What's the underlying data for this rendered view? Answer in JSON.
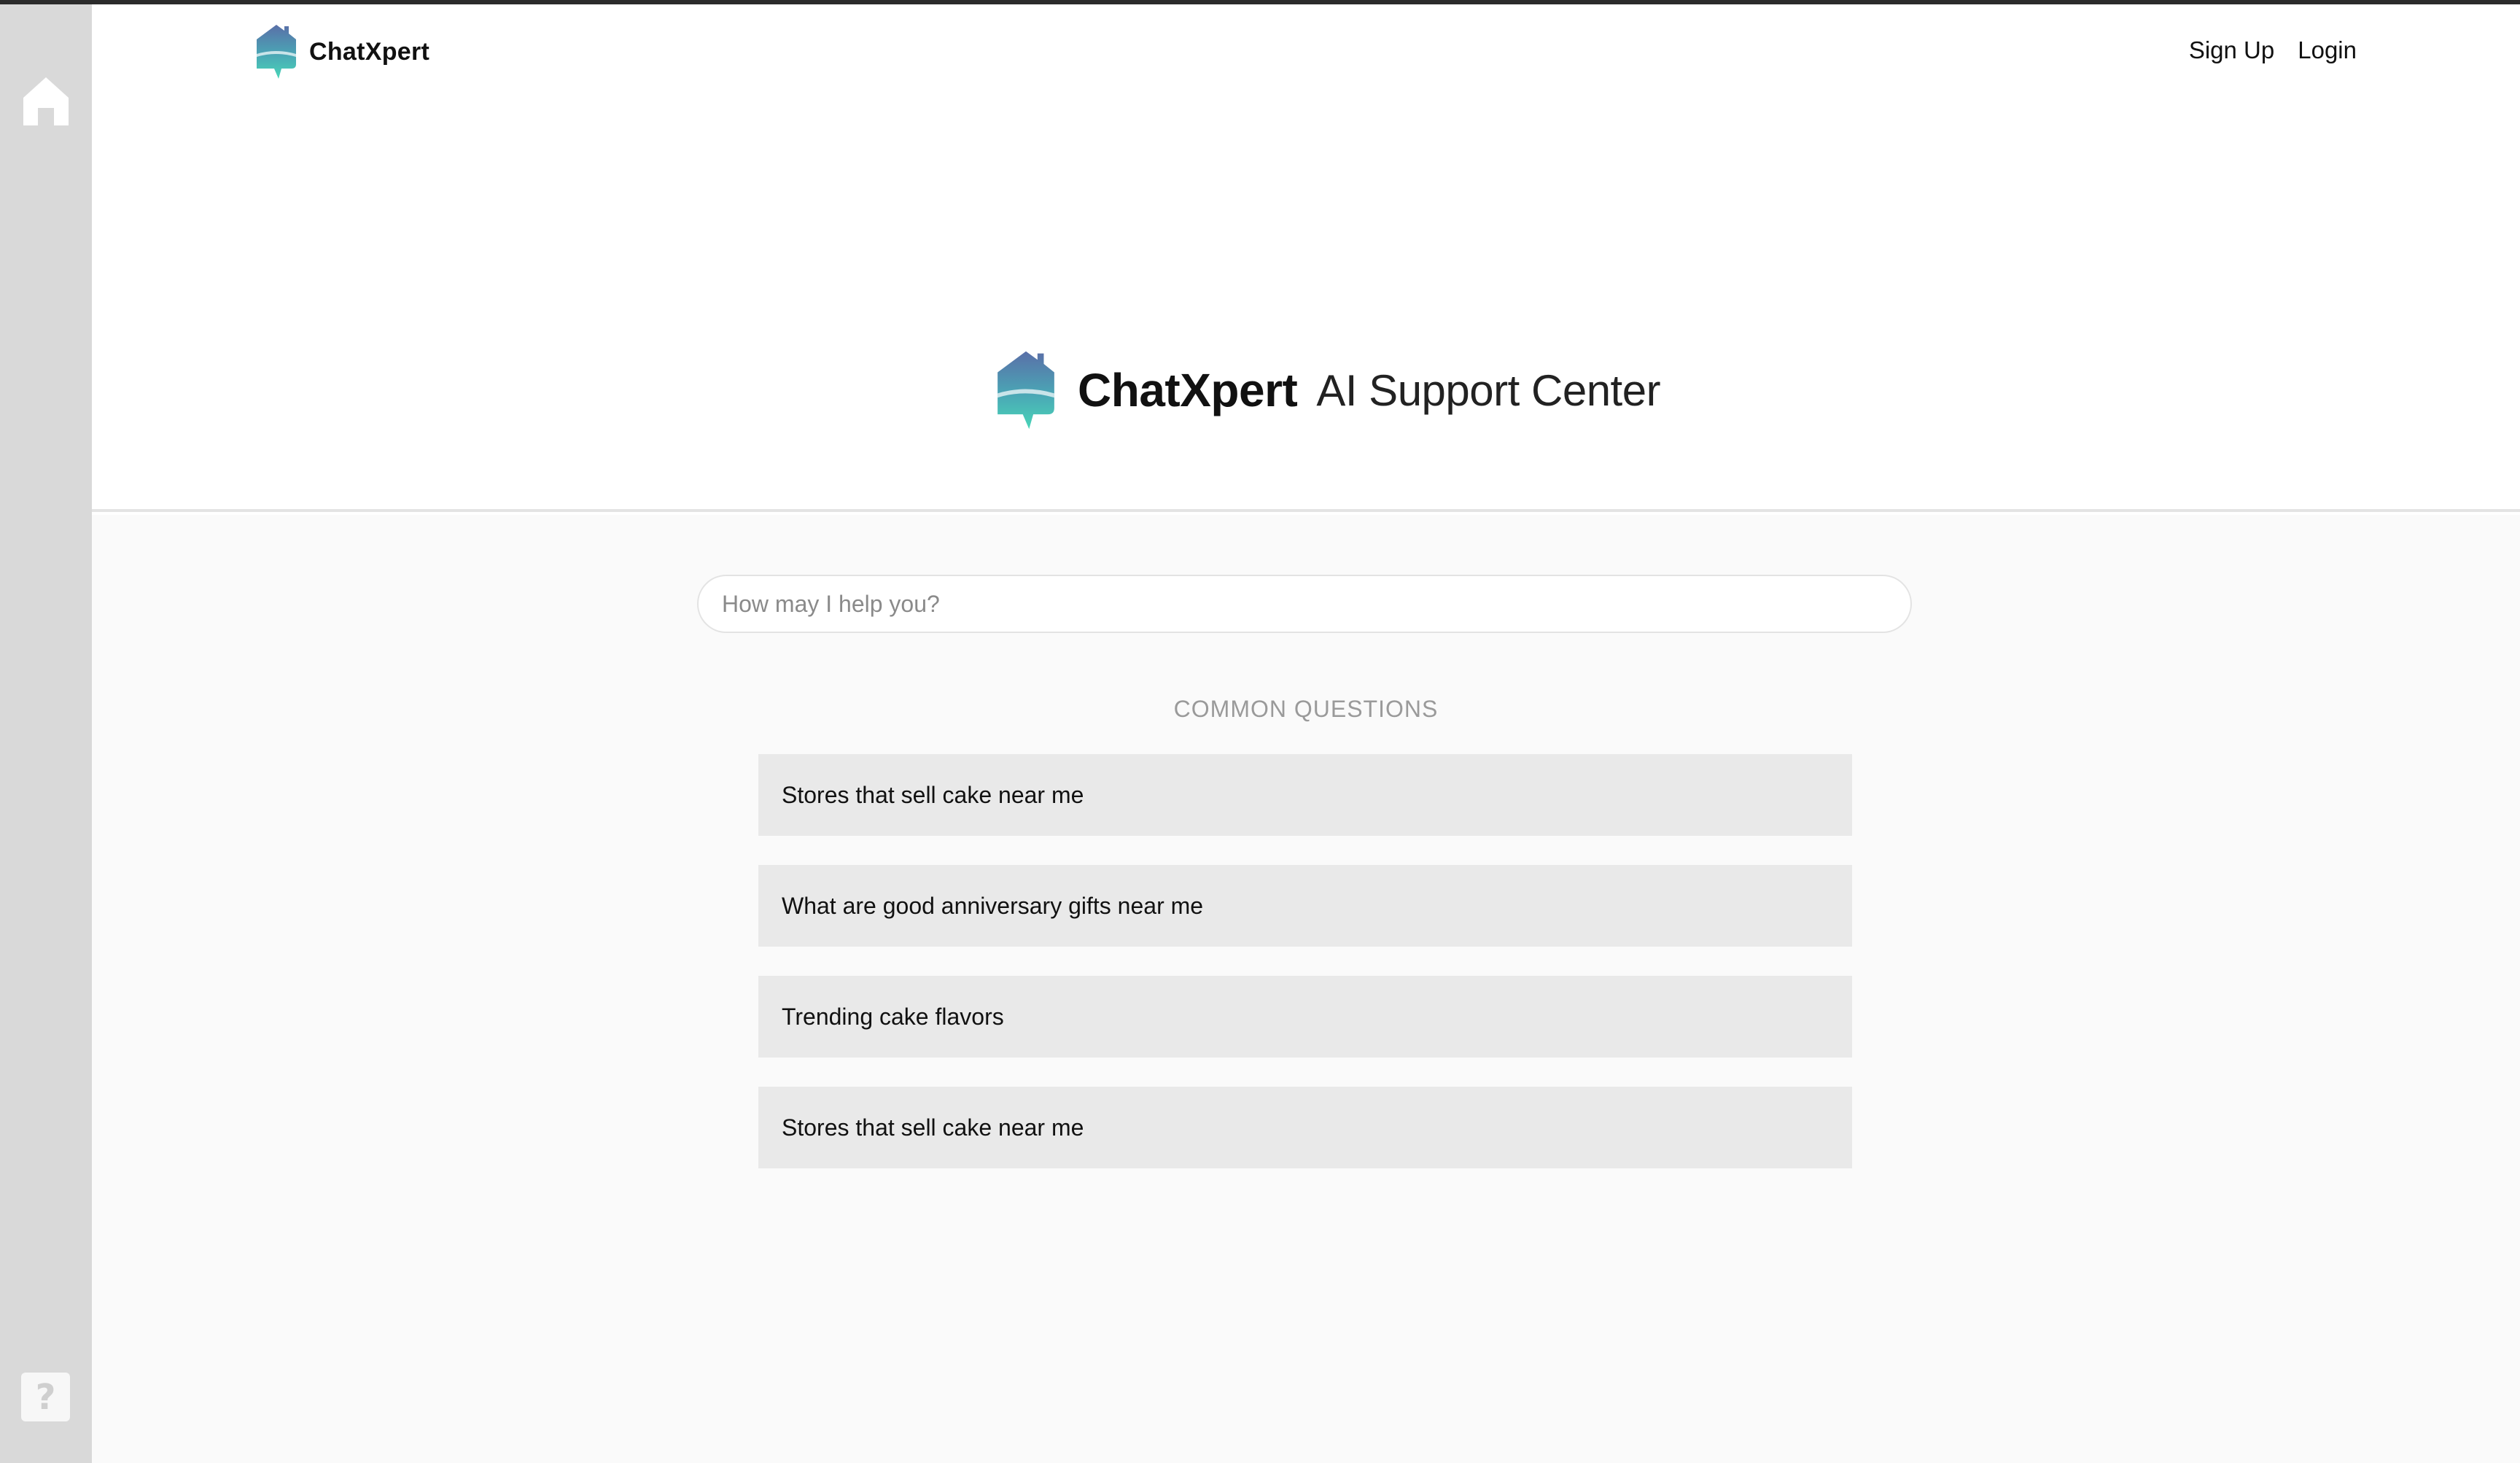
{
  "app": {
    "brand": "ChatXpert"
  },
  "header": {
    "sign_up": "Sign Up",
    "login": "Login"
  },
  "hero": {
    "brand": "ChatXpert",
    "rest": "AI Support Center"
  },
  "search": {
    "placeholder": "How may I help you?"
  },
  "common_questions": {
    "label": "COMMON QUESTIONS",
    "items": [
      {
        "text": "Stores that sell cake near me"
      },
      {
        "text": "What are good anniversary gifts near me"
      },
      {
        "text": "Trending cake flavors"
      },
      {
        "text": "Stores that sell cake near me"
      }
    ]
  },
  "sidebar": {
    "icons": [
      "home-icon",
      "help-icon"
    ],
    "help_glyph": "?"
  },
  "colors": {
    "logo_top": "#5a6fa8",
    "logo_bottom": "#49d6b8",
    "sidebar_bg": "#d9d9d9",
    "question_bg": "#e9e9e9"
  }
}
